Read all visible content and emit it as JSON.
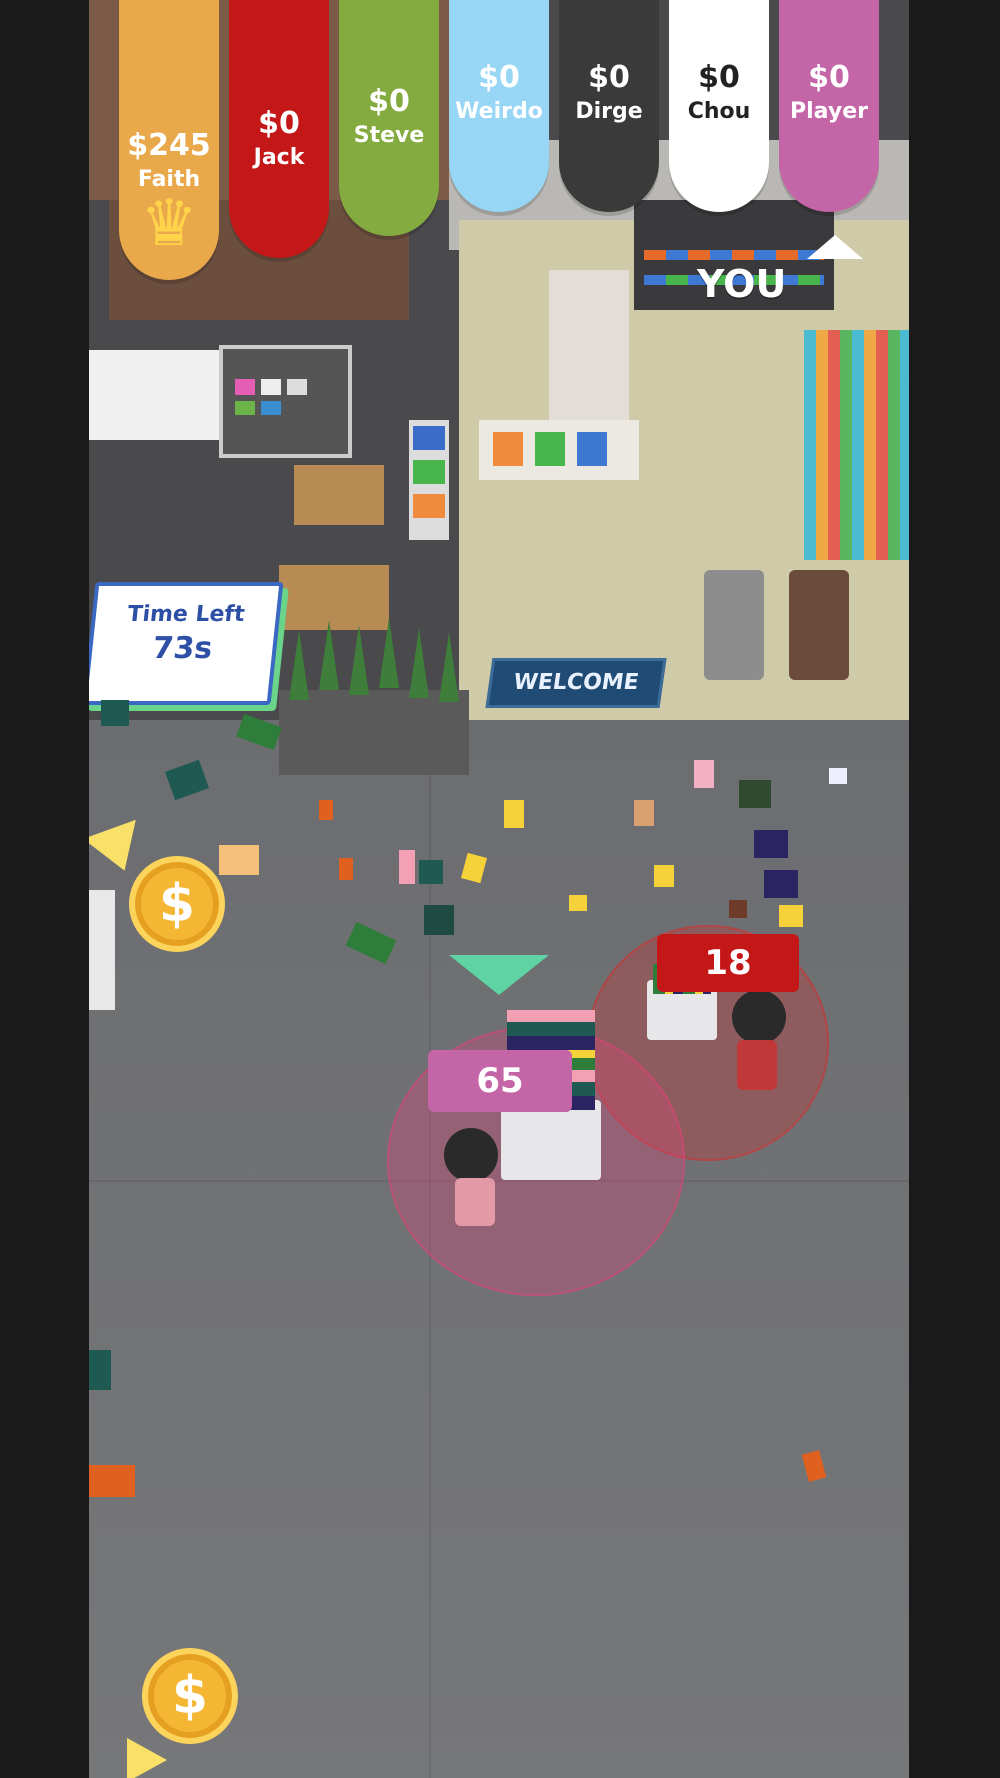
{
  "scoreboard": [
    {
      "money": "$245",
      "name": "Faith",
      "color": "#e9a84a",
      "leader": true
    },
    {
      "money": "$0",
      "name": "Jack",
      "color": "#c41717"
    },
    {
      "money": "$0",
      "name": "Steve",
      "color": "#84ab3f"
    },
    {
      "money": "$0",
      "name": "Weirdo",
      "color": "#98d6f6"
    },
    {
      "money": "$0",
      "name": "Dirge",
      "color": "#3a3a3a"
    },
    {
      "money": "$0",
      "name": "Chou",
      "color": "#ffffff"
    },
    {
      "money": "$0",
      "name": "Player",
      "color": "#c465a7"
    }
  ],
  "you_label": "YOU",
  "timer": {
    "label": "Time Left",
    "value": "73s"
  },
  "welcome_mat": "WELCOME",
  "player_count": "65",
  "rival_count": "18",
  "coin_symbol": "$",
  "colors": {
    "player": "#c465a7",
    "rival": "#c41717",
    "accent": "#3b68c3"
  }
}
